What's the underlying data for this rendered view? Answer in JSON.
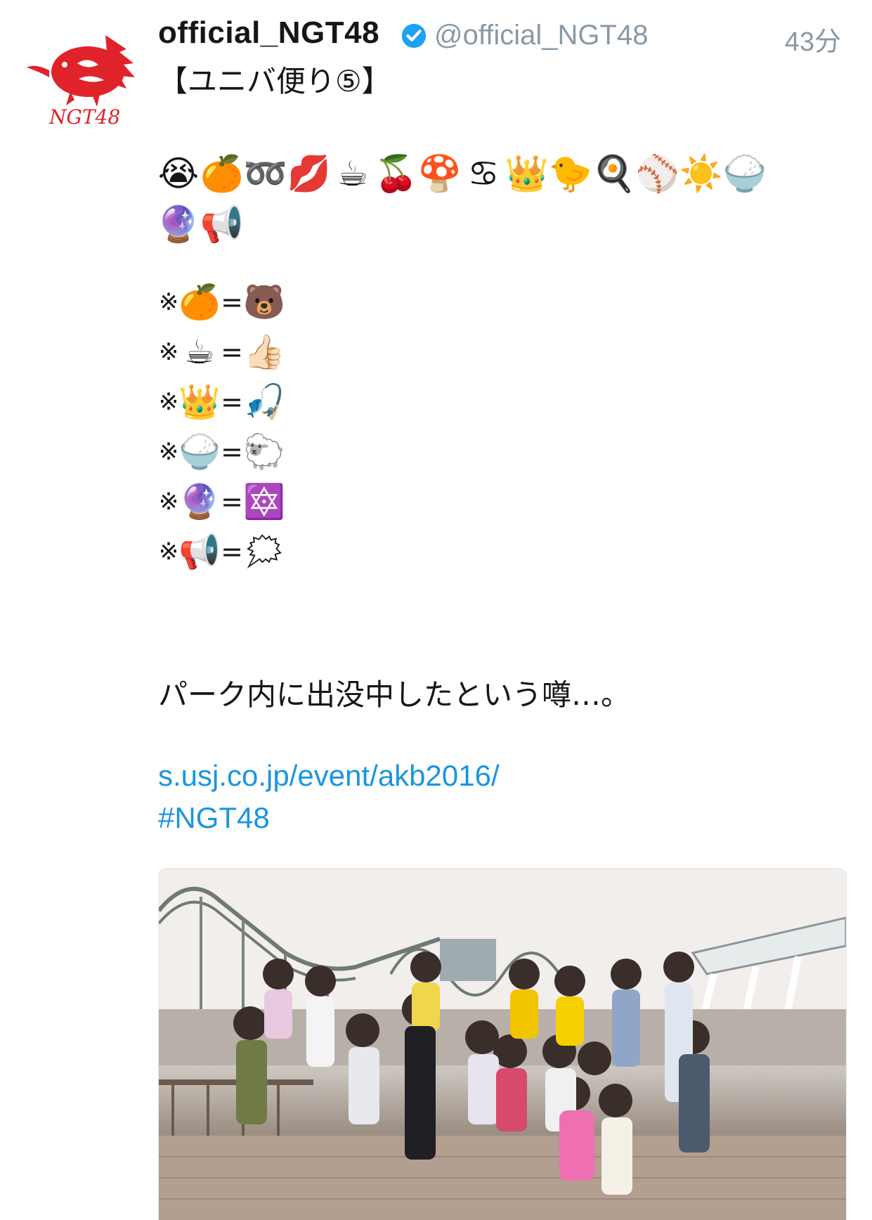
{
  "tweet": {
    "display_name": "official_NGT48",
    "handle": "@official_NGT48",
    "time": "43分",
    "title": "【ユニバ便り⑤】",
    "emoji_line1": [
      "😭",
      "🍊",
      "➿",
      "💋",
      "☕",
      "🍒",
      "🍄",
      "♋",
      "👑",
      "🐤",
      "🍳",
      "⚾",
      "☀️",
      "🍚"
    ],
    "emoji_line2": [
      "🔮",
      "📢"
    ],
    "equations": [
      {
        "mark": "※",
        "left": "🍊",
        "eq": "=",
        "right": "🐻"
      },
      {
        "mark": "※",
        "left": "☕",
        "eq": "=",
        "right": "👍🏻"
      },
      {
        "mark": "※",
        "left": "👑",
        "eq": "=",
        "right": "🎣"
      },
      {
        "mark": "※",
        "left": "🍚",
        "eq": "=",
        "right": "🐑"
      },
      {
        "mark": "※",
        "left": "🔮",
        "eq": "=",
        "right": "🔯"
      },
      {
        "mark": "※",
        "left": "📢",
        "eq": "=",
        "right": "🗯"
      }
    ],
    "body": "パーク内に出没中したという噂…。",
    "link": "s.usj.co.jp/event/akb2016/",
    "hashtag": "#NGT48"
  },
  "avatar": {
    "logo_text": "NGT48",
    "color": "#e0232b"
  },
  "colors": {
    "link": "#1b95e0",
    "muted": "#8899a6",
    "verified": "#1da1f2"
  }
}
